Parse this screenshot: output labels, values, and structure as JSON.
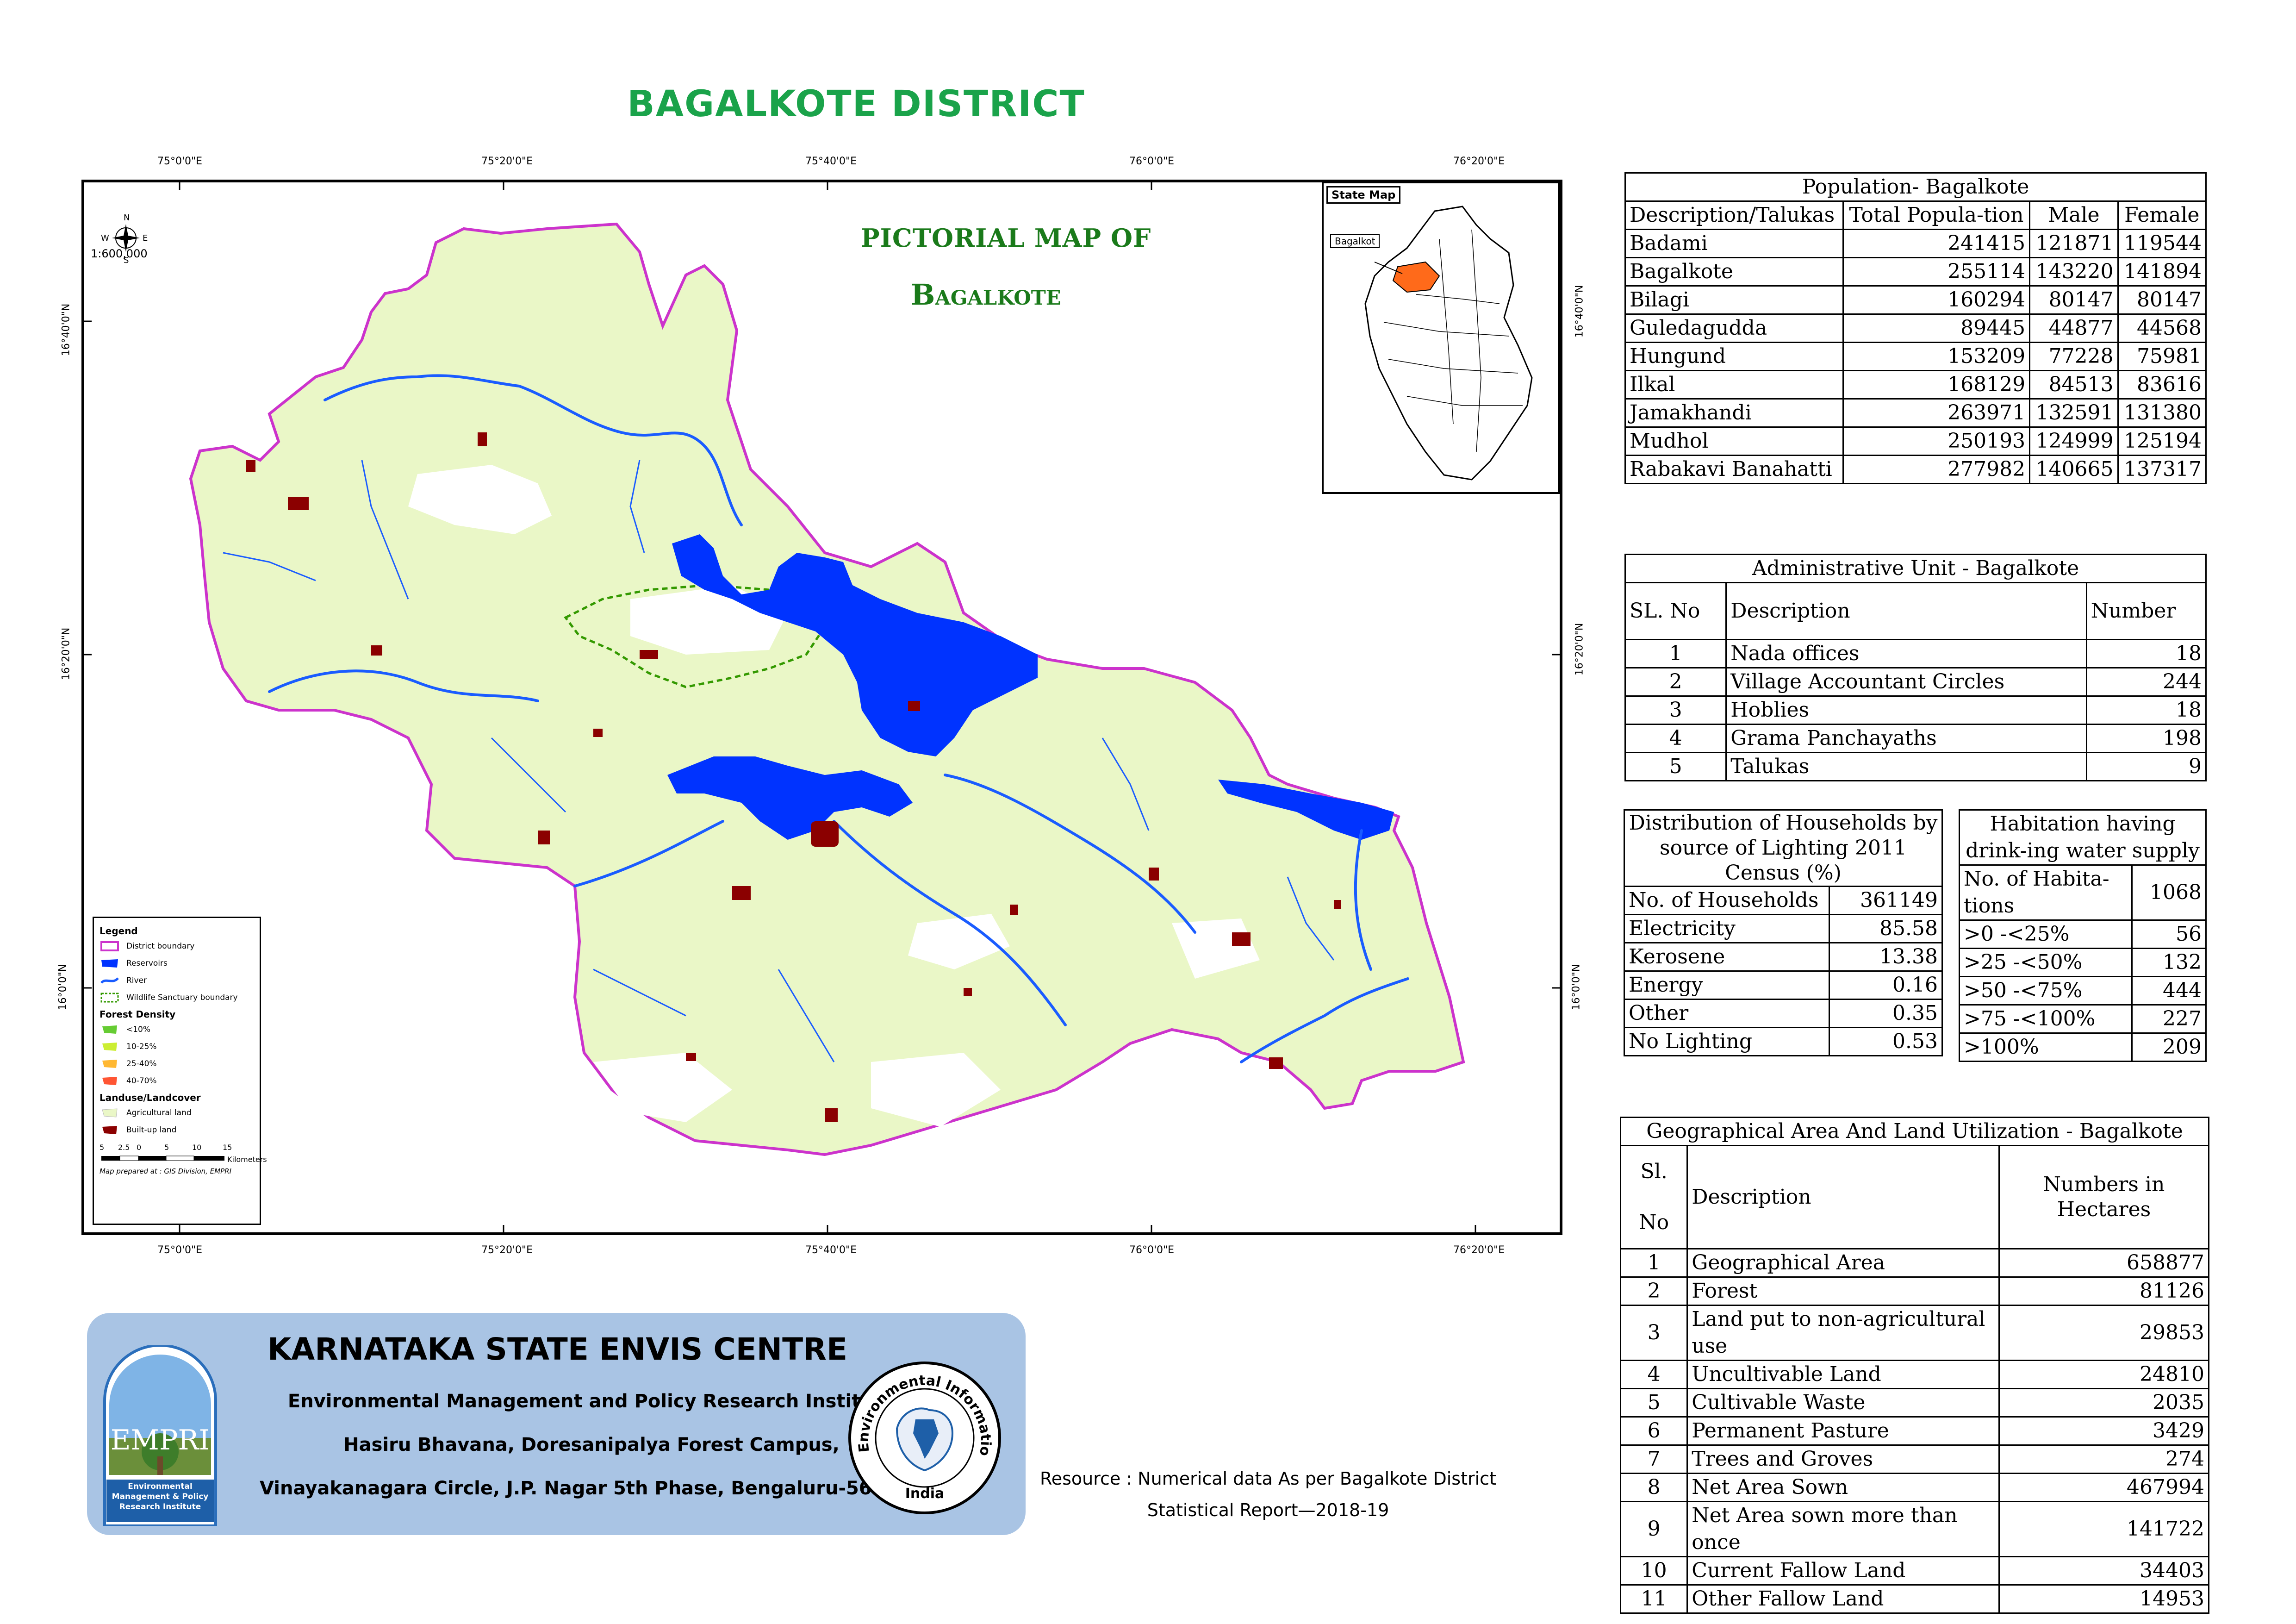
{
  "title": "BAGALKOTE DISTRICT",
  "colors": {
    "title_green": "#1aa34a",
    "pictorial_green": "#1a7a1a",
    "agricultural_land": "#eaf7c7",
    "built_up": "#8b0000",
    "reservoir": "#0033ff",
    "river": "#1a5cff",
    "district_boundary": "#cc33cc",
    "wildlife_boundary": "#339900",
    "state_highlight": "#ff6a1a",
    "banner_blue": "#a9c4e4"
  },
  "map": {
    "pictorial_title_line1": "PICTORIAL MAP OF",
    "pictorial_title_line2": "Bagalkote",
    "scale_text": "1:600,000",
    "compass": {
      "n": "N",
      "s": "S",
      "e": "E",
      "w": "W"
    },
    "top_labels": [
      "75°0'0\"E",
      "75°20'0\"E",
      "75°40'0\"E",
      "76°0'0\"E",
      "76°20'0\"E"
    ],
    "bottom_labels": [
      "75°0'0\"E",
      "75°20'0\"E",
      "75°40'0\"E",
      "76°0'0\"E",
      "76°20'0\"E"
    ],
    "side_labels": [
      "16°40'0\"N",
      "16°20'0\"N",
      "16°0'0\"N"
    ]
  },
  "inset": {
    "title": "State Map",
    "label": "Bagalkot"
  },
  "legend": {
    "title": "Legend",
    "items": [
      {
        "label": "District boundary",
        "icon": "district-boundary-icon"
      },
      {
        "label": "Reservoirs",
        "icon": "reservoir-icon"
      },
      {
        "label": "River",
        "icon": "river-icon"
      },
      {
        "label": "Wildlife Sanctuary boundary",
        "icon": "wildlife-boundary-icon"
      }
    ],
    "forest_density_title": "Forest Density",
    "forest_density": [
      {
        "label": "<10%",
        "color": "#66cc33"
      },
      {
        "label": "10-25%",
        "color": "#ccee33"
      },
      {
        "label": "25-40%",
        "color": "#ffb833"
      },
      {
        "label": "40-70%",
        "color": "#ff5533"
      }
    ],
    "landuse_title": "Landuse/Landcover",
    "landuse": [
      {
        "label": "Agricultural land",
        "color": "#eaf7c7"
      },
      {
        "label": "Built-up land",
        "color": "#8b0000"
      }
    ],
    "scale_ticks": [
      "5",
      "2.5",
      "0",
      "5",
      "10",
      "15"
    ],
    "scale_unit": "Kilometers",
    "credit": "Map prepared at : GIS Division, EMPRI"
  },
  "population": {
    "caption": "Population- Bagalkote",
    "headers": [
      "Description/Talukas",
      "Total Popula-tion",
      "Male",
      "Female"
    ],
    "rows": [
      [
        "Badami",
        "241415",
        "121871",
        "119544"
      ],
      [
        "Bagalkote",
        "255114",
        "143220",
        "141894"
      ],
      [
        "Bilagi",
        "160294",
        "80147",
        "80147"
      ],
      [
        "Guledagudda",
        "89445",
        "44877",
        "44568"
      ],
      [
        "Hungund",
        "153209",
        "77228",
        "75981"
      ],
      [
        "Ilkal",
        "168129",
        "84513",
        "83616"
      ],
      [
        "Jamakhandi",
        "263971",
        "132591",
        "131380"
      ],
      [
        "Mudhol",
        "250193",
        "124999",
        "125194"
      ],
      [
        "Rabakavi Banahatti",
        "277982",
        "140665",
        "137317"
      ]
    ]
  },
  "admin": {
    "caption": "Administrative Unit - Bagalkote",
    "headers": [
      "SL. No",
      "Description",
      "Number"
    ],
    "rows": [
      [
        "1",
        "Nada offices",
        "18"
      ],
      [
        "2",
        "Village Accountant Circles",
        "244"
      ],
      [
        "3",
        "Hoblies",
        "18"
      ],
      [
        "4",
        "Grama Panchayaths",
        "198"
      ],
      [
        "5",
        "Talukas",
        "9"
      ]
    ]
  },
  "households": {
    "caption": "Distribution of Households by source of Lighting 2011 Census (%)",
    "rows": [
      [
        "No. of Households",
        "361149"
      ],
      [
        "Electricity",
        "85.58"
      ],
      [
        "Kerosene",
        "13.38"
      ],
      [
        "Energy",
        "0.16"
      ],
      [
        "Other",
        "0.35"
      ],
      [
        "No Lighting",
        "0.53"
      ]
    ]
  },
  "habitation": {
    "caption": "Habitation having drink-ing water supply",
    "rows": [
      [
        "No. of Habita-tions",
        "1068"
      ],
      [
        ">0 -<25%",
        "56"
      ],
      [
        ">25 -<50%",
        "132"
      ],
      [
        ">50 -<75%",
        "444"
      ],
      [
        ">75 -<100%",
        "227"
      ],
      [
        ">100%",
        "209"
      ]
    ]
  },
  "geo": {
    "caption": "Geographical Area  And Land Utilization - Bagalkote",
    "headers": [
      "Sl. No",
      "Description",
      "Numbers in Hectares"
    ],
    "rows": [
      [
        "1",
        "Geographical Area",
        "658877"
      ],
      [
        "2",
        "Forest",
        "81126"
      ],
      [
        "3",
        "Land put to non-agricultural use",
        "29853"
      ],
      [
        "4",
        "Uncultivable Land",
        "24810"
      ],
      [
        "5",
        "Cultivable Waste",
        "2035"
      ],
      [
        "6",
        "Permanent Pasture",
        "3429"
      ],
      [
        "7",
        "Trees and Groves",
        "274"
      ],
      [
        "8",
        "Net Area Sown",
        "467994"
      ],
      [
        "9",
        "Net Area sown more than once",
        "141722"
      ],
      [
        "10",
        "Current Fallow Land",
        "34403"
      ],
      [
        "11",
        "Other Fallow Land",
        "14953"
      ]
    ]
  },
  "banner": {
    "title": "KARNATAKA STATE ENVIS CENTRE",
    "line1": "Environmental Management and Policy Research Institute",
    "line2": "Hasiru Bhavana, Doresanipalya Forest Campus,",
    "line3": "Vinayakanagara Circle, J.P. Nagar 5th Phase, Bengaluru-560078",
    "empri_logo_text": "EMPRI",
    "empri_caption": "Environmental Management & Policy Research Institute",
    "envis_ring_text": "Environmental Information System",
    "envis_country": "India"
  },
  "resource": {
    "line1": "Resource : Numerical data As per Bagalkote District",
    "line2": "Statistical Report—2018-19"
  }
}
